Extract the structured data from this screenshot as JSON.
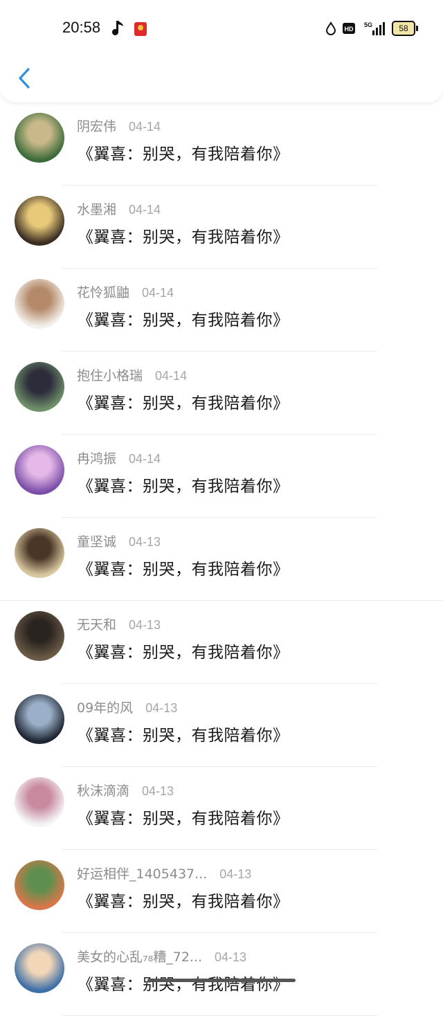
{
  "status_bar": {
    "time": "20:58",
    "battery": "58",
    "icons": [
      "music-note-icon",
      "red-packet-icon",
      "water-drop-icon",
      "hd-icon",
      "5g-signal-icon",
      "battery-icon"
    ]
  },
  "nav": {
    "back_icon": "chevron-left-icon"
  },
  "comments": [
    {
      "name": "阴宏伟",
      "date": "04-14",
      "text": "《翼喜：别哭，有我陪着你》"
    },
    {
      "name": "水墨湘",
      "date": "04-14",
      "text": "《翼喜：别哭，有我陪着你》"
    },
    {
      "name": "花怜狐鼬",
      "date": "04-14",
      "text": "《翼喜：别哭，有我陪着你》"
    },
    {
      "name": "抱住小格瑞",
      "date": "04-14",
      "text": "《翼喜：别哭，有我陪着你》"
    },
    {
      "name": "冉鸿振",
      "date": "04-14",
      "text": "《翼喜：别哭，有我陪着你》"
    },
    {
      "name": "童坚诚",
      "date": "04-13",
      "text": "《翼喜：别哭，有我陪着你》"
    },
    {
      "name": "无天和",
      "date": "04-13",
      "text": "《翼喜：别哭，有我陪着你》"
    },
    {
      "name": "09年的风",
      "date": "04-13",
      "text": "《翼喜：别哭，有我陪着你》"
    },
    {
      "name": "秋沫滴滴",
      "date": "04-13",
      "text": "《翼喜：别哭，有我陪着你》"
    },
    {
      "name": "好运相伴_1405437...",
      "date": "04-13",
      "text": "《翼喜：别哭，有我陪着你》"
    },
    {
      "name": "美女的心乱₇₈糟_72...",
      "date": "04-13",
      "text": "《翼喜：别哭，有我陪着你》"
    }
  ],
  "avatar_colors": [
    [
      "#3c6b3a",
      "#c9b98a"
    ],
    [
      "#3a2d22",
      "#e8c97a"
    ],
    [
      "#f3efe9",
      "#b58a6a"
    ],
    [
      "#6f8f6a",
      "#2c2c3a"
    ],
    [
      "#7b4fa8",
      "#e6b8e8"
    ],
    [
      "#d9c7a0",
      "#4a3626"
    ],
    [
      "#6b5a46",
      "#2a2420"
    ],
    [
      "#1e2633",
      "#9bb0c8"
    ],
    [
      "#f4f4f6",
      "#c98aa0"
    ],
    [
      "#d9774a",
      "#5f8f4e"
    ],
    [
      "#3d6fa8",
      "#f1d6b8"
    ]
  ]
}
